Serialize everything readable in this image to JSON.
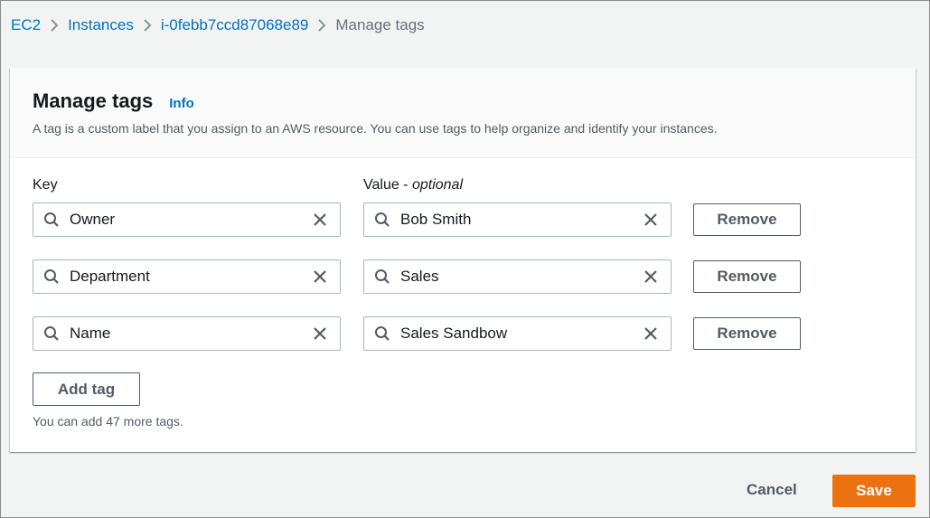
{
  "breadcrumb": {
    "items": [
      "EC2",
      "Instances",
      "i-0febb7ccd87068e89"
    ],
    "current": "Manage tags"
  },
  "panel": {
    "title": "Manage tags",
    "info_label": "Info",
    "description": "A tag is a custom label that you assign to an AWS resource. You can use tags to help organize and identify your instances.",
    "key_label": "Key",
    "value_label": "Value - ",
    "value_optional": "optional",
    "tags": [
      {
        "key": "Owner",
        "value": "Bob Smith",
        "remove_label": "Remove"
      },
      {
        "key": "Department",
        "value": "Sales",
        "remove_label": "Remove"
      },
      {
        "key": "Name",
        "value": "Sales Sandbow",
        "remove_label": "Remove"
      }
    ],
    "add_tag_label": "Add tag",
    "hint": "You can add 47 more tags."
  },
  "footer": {
    "cancel_label": "Cancel",
    "save_label": "Save"
  },
  "colors": {
    "link": "#0073bb",
    "primary": "#ec7211",
    "background": "#f2f3f3"
  },
  "icons": [
    "chevron-right-icon",
    "search-icon",
    "close-icon"
  ]
}
